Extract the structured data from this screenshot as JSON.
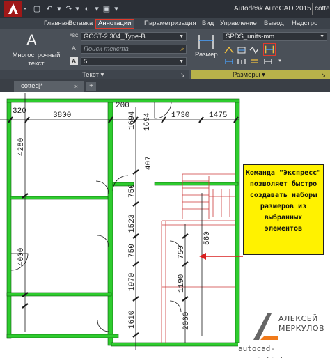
{
  "titlebar": {
    "app_name": "Autodesk AutoCAD 2015",
    "file_fragment": "cotte"
  },
  "ribbon_tabs": [
    {
      "label": "Главная",
      "active": false
    },
    {
      "label": "Вставка",
      "active": false
    },
    {
      "label": "Аннотации",
      "active": true
    },
    {
      "label": "Параметризация",
      "active": false
    },
    {
      "label": "Вид",
      "active": false
    },
    {
      "label": "Управление",
      "active": false
    },
    {
      "label": "Вывод",
      "active": false
    },
    {
      "label": "Надстро",
      "active": false
    }
  ],
  "panel_text": {
    "mtext_icon": "A",
    "mtext_label_1": "Многострочный",
    "mtext_label_2": "текст",
    "text_style": "GOST-2.304_Type-B",
    "search_placeholder": "Поиск текста",
    "text_height": "5",
    "footer": "Текст ▾"
  },
  "panel_dims": {
    "dim_button_label": "Размер",
    "dim_style": "SPDS_units-mm",
    "footer": "Размеры ▾"
  },
  "filetab": {
    "name": "cottedj*",
    "close": "×",
    "new": "+"
  },
  "drawing": {
    "dims_top": [
      "320",
      "3800",
      "200",
      "1694",
      "1730",
      "1475"
    ],
    "dims_left": [
      "4280",
      "4000"
    ],
    "dims_mid": [
      "1694",
      "407",
      "750",
      "1523",
      "750",
      "1970",
      "2060"
    ],
    "dims_right": [
      "750",
      "560",
      "1190"
    ]
  },
  "callout": {
    "lines": [
      "Команда \"Экспресс\"",
      "позволяет быстро",
      "создавать наборы",
      "размеров из",
      "выбранных",
      "элементов"
    ]
  },
  "brand": {
    "name_1": "АЛЕКСЕЙ",
    "name_2": "МЕРКУЛОВ",
    "url": "autocad-specialist.ru"
  },
  "colors": {
    "ribbon_bg": "#4a5058",
    "active_tab_border": "#e03a2c",
    "wall_green": "#2ecc2e",
    "dim_line": "#1a1a1a",
    "arrow_red": "#d92020",
    "callout_bg": "#fff200"
  }
}
